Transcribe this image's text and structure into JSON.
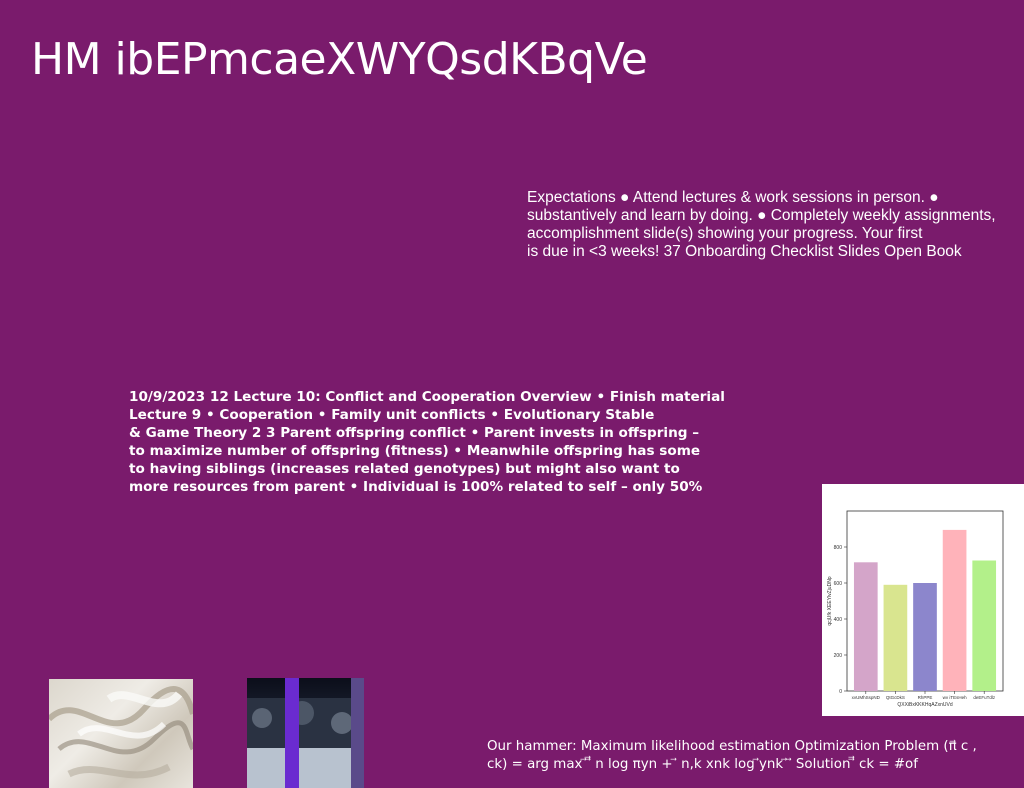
{
  "title": "HM ibEPmcaeXWYQsdKBqVe",
  "expectations": {
    "lines": [
      "Expectations ● Attend lectures & work sessions in person. ●",
      "substantively and learn by doing. ● Completely weekly assignments,",
      "accomplishment slide(s) showing your progress. Your first",
      "is due in <3 weeks! 37 Onboarding Checklist Slides Open Book"
    ]
  },
  "lecture": {
    "lines": [
      "10/9/2023 12 Lecture 10: Conflict and Cooperation Overview • Finish material",
      "Lecture 9 • Cooperation • Family unit conflicts • Evolutionary Stable",
      "& Game Theory 2 3 Parent offspring conflict • Parent invests in offspring –",
      "to maximize number of offspring (fitness) • Meanwhile offspring has some",
      "to having siblings (increases related genotypes) but might also want to",
      "more resources from parent • Individual is 100% related to self – only 50%"
    ]
  },
  "hammer": {
    "lines": [
      "Our hammer: Maximum likelihood estimation Optimization Problem (π⃗ c ,",
      "ck) = arg max ⃗ ⃗⃗ n log πyn + ⃗ n,k xnk log ⃗ynk ⃗ ⃗ Solution ⃗⃗ ck = #of"
    ]
  },
  "chart_data": {
    "type": "bar",
    "categories": [
      "xvUMhSspND",
      "QtGcDkS",
      "RhPPE",
      "wv iTEsHeh",
      "deEFuTdlz"
    ],
    "values": [
      715,
      590,
      600,
      895,
      725
    ],
    "colors": [
      "#d4a5c9",
      "#d9e58f",
      "#8c86cc",
      "#ffb3ba",
      "#b3f08a"
    ],
    "xlabel": "QXXiBxKKKHqAZxnUVd",
    "ylabel": "qcjUfk XEEYlvZjuDNp",
    "yticks": [
      0,
      200,
      400,
      600,
      800
    ],
    "ylim": [
      0,
      1000
    ]
  }
}
